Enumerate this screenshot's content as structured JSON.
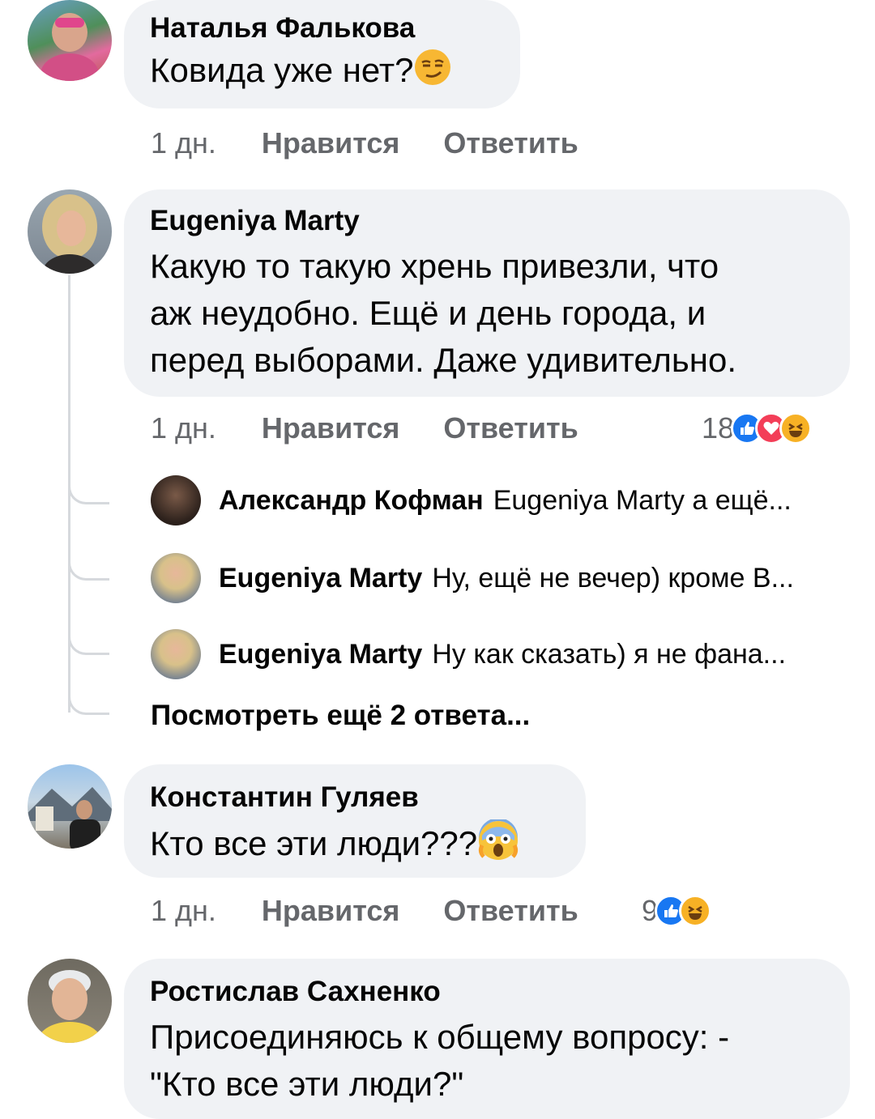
{
  "comments": [
    {
      "author": "Наталья Фалькова",
      "text": "Ковида уже нет?",
      "emoji": "smirking-face",
      "time": "1 дн.",
      "like_label": "Нравится",
      "reply_label": "Ответить"
    },
    {
      "author": "Eugeniya Marty",
      "text_lines": [
        "Какую то такую хрень привезли, что",
        "аж неудобно. Ещё и день города, и",
        "перед выборами. Даже удивительно."
      ],
      "time": "1 дн.",
      "like_label": "Нравится",
      "reply_label": "Ответить",
      "reaction_count": "18",
      "reactions": [
        "like-icon",
        "love-icon",
        "haha-icon"
      ],
      "replies": [
        {
          "author": "Александр Кофман",
          "preview": "Eugeniya Marty а ещё..."
        },
        {
          "author": "Eugeniya Marty",
          "preview": "Ну, ещё не вечер) кроме В..."
        },
        {
          "author": "Eugeniya Marty",
          "preview": "Ну как сказать) я не фана..."
        }
      ],
      "more_replies": "Посмотреть ещё 2 ответа..."
    },
    {
      "author": "Константин Гуляев",
      "text": "Кто все эти люди???",
      "emoji": "screaming-face",
      "time": "1 дн.",
      "like_label": "Нравится",
      "reply_label": "Ответить",
      "reaction_count": "9",
      "reactions": [
        "like-icon",
        "haha-icon"
      ]
    },
    {
      "author": "Ростислав Сахненко",
      "text_lines": [
        "Присоединяюсь к общему вопросу: -",
        "\"Кто все эти люди?\""
      ]
    }
  ],
  "colors": {
    "bubble": "#f0f2f5",
    "meta": "#65676b",
    "like": "#1877f2",
    "love": "#f33e58",
    "haha": "#f7b125"
  }
}
